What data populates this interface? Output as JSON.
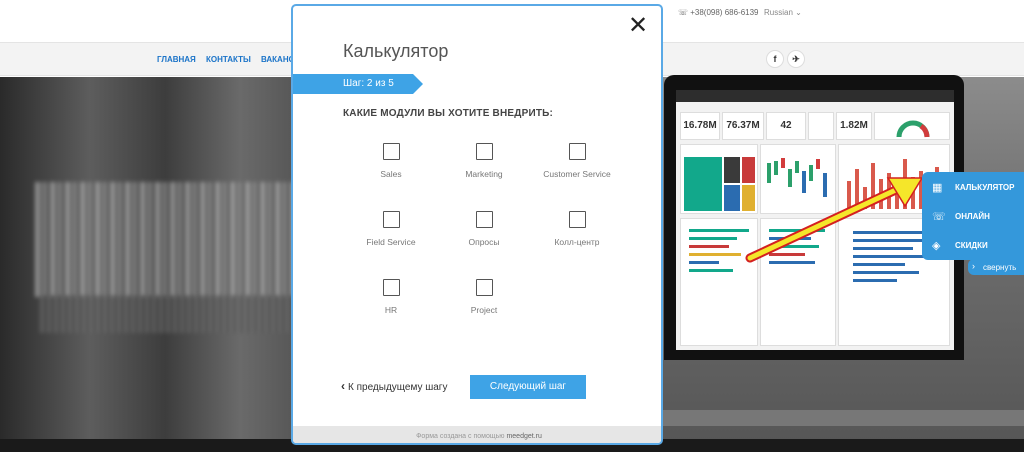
{
  "topbar": {
    "phone": "☏ +38(098) 686-6139",
    "language": "Russian ⌄"
  },
  "nav": {
    "items": [
      "ГЛАВНАЯ",
      "КОНТАКТЫ",
      "ВАКАНС"
    ],
    "social": [
      "f",
      "✈"
    ]
  },
  "dashboard": {
    "kpis": [
      "16.78M",
      "76.37M",
      "42",
      "1.82M"
    ]
  },
  "widget": {
    "items": [
      {
        "icon": "calculator-icon",
        "label": "КАЛЬКУЛЯТОР"
      },
      {
        "icon": "phone-icon",
        "label": "ОНЛАЙН"
      },
      {
        "icon": "tag-icon",
        "label": "СКИДКИ"
      }
    ],
    "collapse_label": "свернуть"
  },
  "modal": {
    "title": "Калькулятор",
    "close": "✕",
    "step": "Шаг: 2 из 5",
    "question": "КАКИЕ МОДУЛИ ВЫ ХОТИТЕ ВНЕДРИТЬ:",
    "options": [
      "Sales",
      "Marketing",
      "Customer Service",
      "Field Service",
      "Опросы",
      "Колл-центр",
      "HR",
      "Project"
    ],
    "prev_label": "К предыдущему шагу",
    "next_label": "Следующий шаг",
    "footer_text": "Форма создана с помощью",
    "footer_link": "meedget.ru"
  },
  "colors": {
    "accent": "#3ea3e6",
    "widget": "#3498db",
    "nav_link": "#1a73c8"
  }
}
